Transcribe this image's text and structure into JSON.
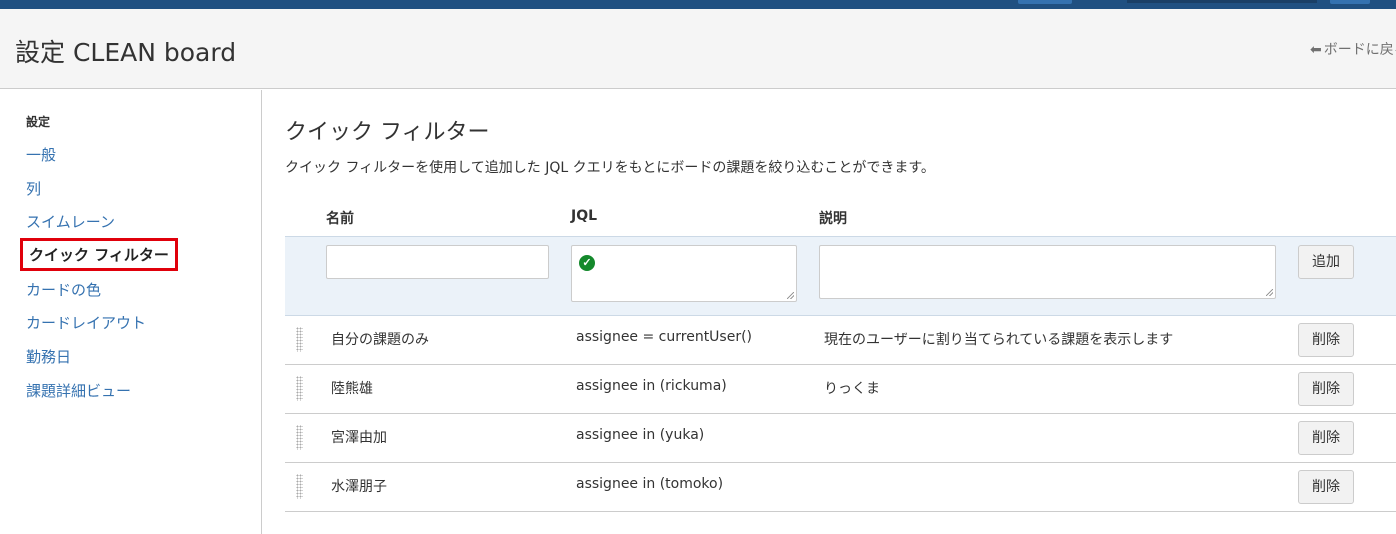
{
  "header": {
    "title": "設定 CLEAN board",
    "back_link": "ボードに戻る"
  },
  "sidebar": {
    "heading": "設定",
    "items": [
      {
        "label": "一般"
      },
      {
        "label": "列"
      },
      {
        "label": "スイムレーン"
      },
      {
        "label": "クイック フィルター",
        "active": true
      },
      {
        "label": "カードの色"
      },
      {
        "label": "カードレイアウト"
      },
      {
        "label": "勤務日"
      },
      {
        "label": "課題詳細ビュー"
      }
    ]
  },
  "main": {
    "title": "クイック フィルター",
    "description": "クイック フィルターを使用して追加した JQL クエリをもとにボードの課題を絞り込むことができます。",
    "columns": {
      "name": "名前",
      "jql": "JQL",
      "description": "説明"
    },
    "add_form": {
      "name_value": "",
      "jql_value": "",
      "description_value": "",
      "add_button": "追加",
      "jql_status": "valid"
    },
    "filters": [
      {
        "name": "自分の課題のみ",
        "jql": "assignee = currentUser()",
        "description": "現在のユーザーに割り当てられている課題を表示します",
        "delete_label": "削除"
      },
      {
        "name": "陸熊雄",
        "jql": "assignee in (rickuma)",
        "description": "りっくま",
        "delete_label": "削除"
      },
      {
        "name": "宮澤由加",
        "jql": "assignee in (yuka)",
        "description": "",
        "delete_label": "削除"
      },
      {
        "name": "水澤朋子",
        "jql": "assignee in (tomoko)",
        "description": "",
        "delete_label": "削除"
      }
    ]
  },
  "colors": {
    "topbar": "#205081",
    "link": "#3572b0",
    "highlight_border": "#e0000b",
    "add_row_bg": "#ebf2f9",
    "valid_icon": "#14892c"
  }
}
